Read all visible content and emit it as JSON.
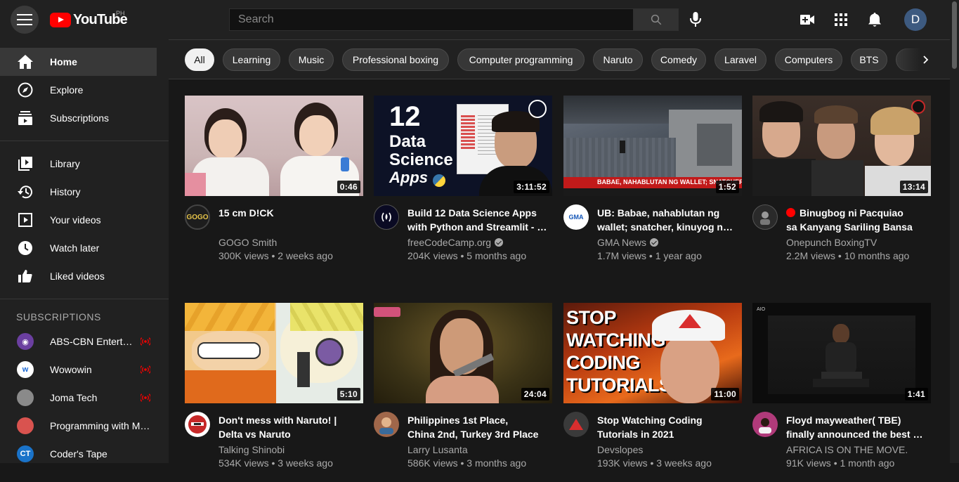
{
  "header": {
    "logo_text": "YouTube",
    "region": "PH",
    "search_placeholder": "Search",
    "avatar_letter": "D"
  },
  "sidebar": {
    "main": [
      {
        "label": "Home",
        "icon": "home-icon"
      },
      {
        "label": "Explore",
        "icon": "compass-icon"
      },
      {
        "label": "Subscriptions",
        "icon": "subscriptions-icon"
      }
    ],
    "library": [
      {
        "label": "Library",
        "icon": "library-icon"
      },
      {
        "label": "History",
        "icon": "history-icon"
      },
      {
        "label": "Your videos",
        "icon": "your-videos-icon"
      },
      {
        "label": "Watch later",
        "icon": "clock-icon"
      },
      {
        "label": "Liked videos",
        "icon": "thumbs-up-icon"
      }
    ],
    "subscriptions_heading": "SUBSCRIPTIONS",
    "subscriptions": [
      {
        "label": "ABS-CBN Entertainment",
        "live": true,
        "color": "#6b3fa0"
      },
      {
        "label": "Wowowin",
        "live": true,
        "color": "#1e6bd6"
      },
      {
        "label": "Joma Tech",
        "live": true,
        "color": "#777777"
      },
      {
        "label": "Programming with Mosh",
        "live": false,
        "color": "#d9534f"
      },
      {
        "label": "Coder's Tape",
        "live": false,
        "color": "#1a73c9"
      }
    ]
  },
  "chips": [
    "All",
    "Learning",
    "Music",
    "Professional boxing",
    "Computer programming",
    "Naruto",
    "Comedy",
    "Laravel",
    "Computers",
    "BTS"
  ],
  "videos": [
    {
      "title1": "15 cm D!CK",
      "title2": "",
      "channel": "GOGO Smith",
      "verified": false,
      "stats": "300K views • 2 weeks ago",
      "duration": "0:46",
      "live_dot": false
    },
    {
      "title1": "Build 12 Data Science Apps",
      "title2": "with Python and Streamlit - Full Course",
      "channel": "freeCodeCamp.org",
      "verified": true,
      "stats": "204K views • 5 months ago",
      "duration": "3:11:52",
      "live_dot": false
    },
    {
      "title1": "UB: Babae, nahablutan ng",
      "title2": "wallet; snatcher, kinuyog ng tambay",
      "channel": "GMA News",
      "verified": true,
      "stats": "1.7M views • 1 year ago",
      "duration": "1:52",
      "live_dot": false
    },
    {
      "title1": "Binugbog ni Pacquiao",
      "title2": "sa Kanyang Sariling Bansa",
      "channel": "Onepunch BoxingTV",
      "verified": false,
      "stats": "2.2M views • 10 months ago",
      "duration": "13:14",
      "live_dot": true
    },
    {
      "title1": "Don't mess with Naruto! |",
      "title2": "Delta vs Naruto",
      "channel": "Talking Shinobi",
      "verified": false,
      "stats": "534K views • 3 weeks ago",
      "duration": "5:10",
      "live_dot": false
    },
    {
      "title1": "Philippines 1st Place,",
      "title2": "China 2nd, Turkey 3rd Place",
      "channel": "Larry Lusanta",
      "verified": false,
      "stats": "586K views • 3 months ago",
      "duration": "24:04",
      "live_dot": false
    },
    {
      "title1": "Stop Watching Coding",
      "title2": "Tutorials in 2021",
      "channel": "Devslopes",
      "verified": false,
      "stats": "193K views • 3 weeks ago",
      "duration": "11:00",
      "live_dot": false
    },
    {
      "title1": "Floyd mayweather( TBE)",
      "title2": "finally announced the best boxer",
      "channel": "AFRICA IS ON THE MOVE.",
      "verified": false,
      "stats": "91K views • 1 month ago",
      "duration": "1:41",
      "live_dot": false
    }
  ],
  "thumb_text": {
    "v2_big": "12",
    "v2_line1": "Data",
    "v2_line2": "Science",
    "v2_line3": "Apps",
    "v3_banner": "BABAE, NAHABLUTAN NG WALLET; SNATCHER, KINUYOG NG TAMBAY",
    "v7_line1": "STOP",
    "v7_line2": "WATCHING",
    "v7_line3": "CODING",
    "v7_line4": "TUTORIALS"
  }
}
